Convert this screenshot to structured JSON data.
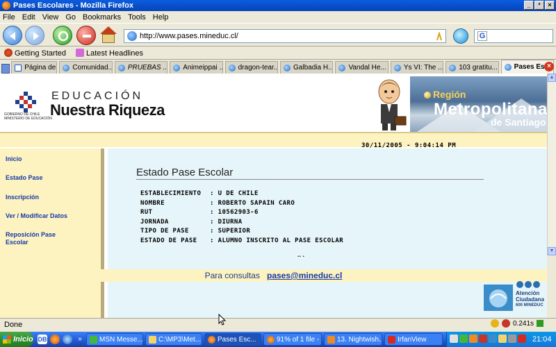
{
  "window": {
    "title": "Pases Escolares - Mozilla Firefox",
    "controls": [
      "_",
      "²",
      "×"
    ]
  },
  "menu": {
    "items": [
      "File",
      "Edit",
      "View",
      "Go",
      "Bookmarks",
      "Tools",
      "Help"
    ]
  },
  "navigation": {
    "url": "http://www.pases.mineduc.cl/",
    "search_placeholder": ""
  },
  "bookmarks": {
    "items": [
      "Getting Started",
      "Latest Headlines"
    ]
  },
  "tabs": [
    {
      "label": "Página de i..."
    },
    {
      "label": "Comunidad..."
    },
    {
      "label": "PRUEBAS ..."
    },
    {
      "label": "Animeippai ..."
    },
    {
      "label": "dragon-tear..."
    },
    {
      "label": "Galbadia H..."
    },
    {
      "label": "Vandal He..."
    },
    {
      "label": "Ys VI: The ..."
    },
    {
      "label": "103 gratitu..."
    },
    {
      "label": "Pases Es..."
    }
  ],
  "site": {
    "logo_small": "GOBIERNO DE CHILE MINISTERIO DE EDUCACIÓN",
    "logo_line1": "EDUCACIÓN",
    "logo_line2": "Nuestra Riqueza",
    "region_label": "Región",
    "region_name": "Metropolitana",
    "region_sub": "de Santiago",
    "datetime": "30/11/2005 - 9:04:14 PM",
    "sidebar": [
      "Inicio",
      "Estado Pase",
      "Inscripción",
      "Ver / Modificar Datos",
      "Reposición Pase Escolar"
    ],
    "main_title": "Estado Pase Escolar",
    "rows": [
      {
        "label": "ESTABLECIMIENTO",
        "value": ": U DE CHILE"
      },
      {
        "label": "NOMBRE",
        "value": ": ROBERTO SAPAIN CARO"
      },
      {
        "label": "RUT",
        "value": ": 10562903-6"
      },
      {
        "label": "JORNADA",
        "value": ": DIURNA"
      },
      {
        "label": "TIPO DE PASE",
        "value": ": SUPERIOR"
      },
      {
        "label": "ESTADO DE PASE",
        "value": ": ALUMNO INSCRITO AL PASE ESCOLAR"
      }
    ],
    "dots": ".. .",
    "consultas_label": "Para consultas",
    "consultas_email": "pases@mineduc.cl",
    "atencion_line1": "Atención",
    "atencion_line2": "Ciudadana",
    "atencion_line3": "600 MINEDUC"
  },
  "status": {
    "text": "Done",
    "timing": "0.241s"
  },
  "taskbar": {
    "start_label": "Inicio",
    "tasks": [
      {
        "label": "MSN Messe..."
      },
      {
        "label": "C:\\MP3\\Met..."
      },
      {
        "label": "Pases Esc..."
      },
      {
        "label": "91% of 1 file - ..."
      },
      {
        "label": "13. Nightwish..."
      },
      {
        "label": "IrfanView"
      }
    ],
    "clock": "21:04"
  },
  "colors": {
    "sidebar_bg": "#fdf3c0",
    "main_bg": "#e6f5f9",
    "link": "#1738a8"
  }
}
